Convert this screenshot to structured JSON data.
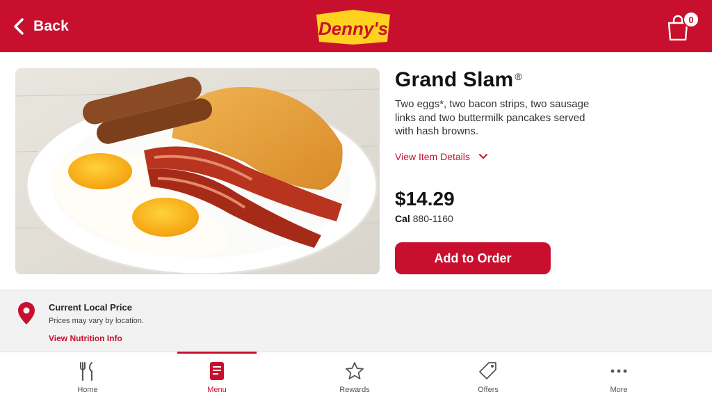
{
  "header": {
    "back_label": "Back",
    "logo_text": "Denny's",
    "cart_count": "0"
  },
  "product": {
    "title": "Grand Slam",
    "title_mark": "®",
    "description": "Two eggs*, two bacon strips, two sausage links and two buttermilk pancakes served with hash browns.",
    "details_link": "View Item Details",
    "price": "$14.29",
    "cal_label": "Cal",
    "cal_range": "880-1160",
    "add_button": "Add to Order"
  },
  "local_price": {
    "title": "Current Local Price",
    "subtitle": "Prices may vary by location.",
    "link": "View Nutrition Info"
  },
  "nav": {
    "items": [
      {
        "label": "Home",
        "icon": "fork-knife-icon"
      },
      {
        "label": "Menu",
        "icon": "menu-card-icon",
        "active": true
      },
      {
        "label": "Rewards",
        "icon": "star-icon"
      },
      {
        "label": "Offers",
        "icon": "tag-icon"
      },
      {
        "label": "More",
        "icon": "more-dots-icon"
      }
    ]
  },
  "colors": {
    "brand_red": "#c8102e",
    "logo_yellow": "#ffd21f",
    "strip_bg": "#f2f2f2"
  }
}
